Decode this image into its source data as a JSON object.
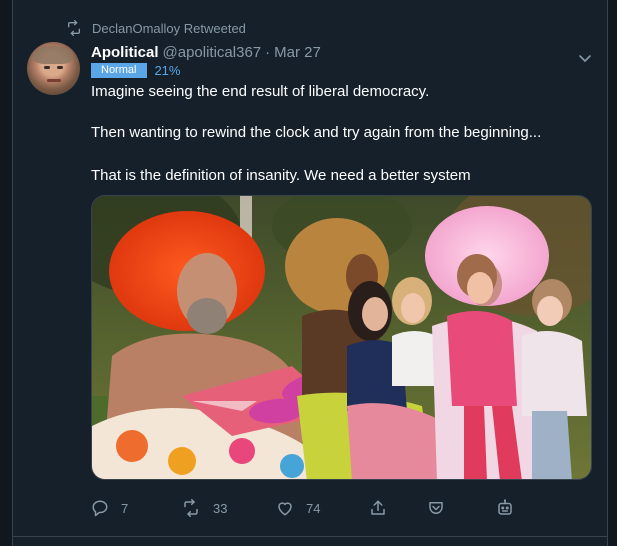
{
  "retweet_context": {
    "label": "DeclanOmalloy Retweeted"
  },
  "tweet": {
    "display_name": "Apolitical",
    "handle": "@apolitical367",
    "separator": "·",
    "date": "Mar 27",
    "badge": {
      "label": "Normal",
      "percent": "21%",
      "color": "#5aa6e6"
    },
    "lines": [
      "Imagine seeing the end result of liberal democracy.",
      "Then wanting to rewind the clock and try again from the beginning...",
      "That is the definition of insanity. We need a better system"
    ]
  },
  "actions": {
    "reply": {
      "icon": "reply-icon",
      "count": "7"
    },
    "retweet": {
      "icon": "retweet-icon",
      "count": "33"
    },
    "like": {
      "icon": "heart-icon",
      "count": "74"
    },
    "share": {
      "icon": "share-icon"
    },
    "pocket": {
      "icon": "pocket-icon"
    },
    "bot": {
      "icon": "robot-icon"
    }
  },
  "colors": {
    "background": "#15202b",
    "frame": "#10171e",
    "muted_text": "#8899a6",
    "primary_text": "#ffffff",
    "border": "#38444d"
  }
}
